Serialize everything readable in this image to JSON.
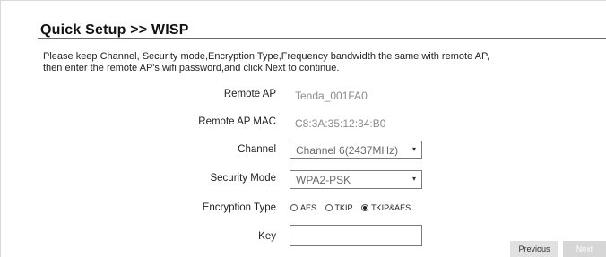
{
  "header": {
    "title": "Quick Setup >>  WISP"
  },
  "intro": {
    "line1": "Please keep Channel, Security mode,Encryption Type,Frequency bandwidth the same with remote AP,",
    "line2": "then enter the remote AP's wifi password,and click Next to continue."
  },
  "form": {
    "remote_ap_label": "Remote AP",
    "remote_ap_value": "Tenda_001FA0",
    "remote_ap_mac_label": "Remote AP MAC",
    "remote_ap_mac_value": "C8:3A:35:12:34:B0",
    "channel_label": "Channel",
    "channel_value": "Channel 6(2437MHz)",
    "security_mode_label": "Security Mode",
    "security_mode_value": "WPA2-PSK",
    "encryption_label": "Encryption Type",
    "encryption_options": [
      "AES",
      "TKIP",
      "TKIP&AES"
    ],
    "encryption_selected": "TKIP&AES",
    "key_label": "Key",
    "key_value": ""
  },
  "buttons": {
    "previous": "Previous",
    "next": "Next"
  },
  "icons": {
    "select_caret": "▾"
  }
}
